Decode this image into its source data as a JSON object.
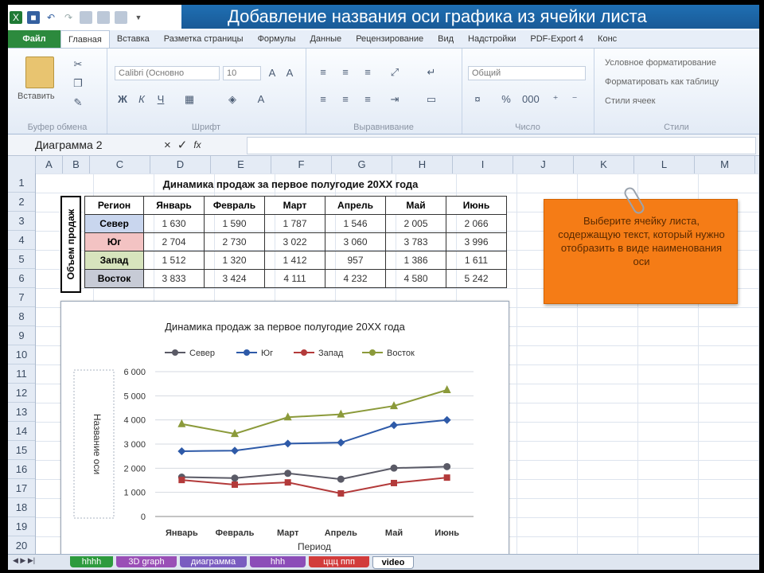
{
  "window": {
    "title_banner": "Добавление названия оси графика из ячейки листа"
  },
  "ribbon": {
    "file_tab": "Файл",
    "tabs": [
      "Главная",
      "Вставка",
      "Разметка страницы",
      "Формулы",
      "Данные",
      "Рецензирование",
      "Вид",
      "Надстройки",
      "PDF-Export 4",
      "Конс"
    ],
    "active_tab": "Главная",
    "clipboard": {
      "paste_label": "Вставить",
      "group_label": "Буфер обмена"
    },
    "font": {
      "font_name": "Calibri (Основно",
      "font_size": "10",
      "group_label": "Шрифт"
    },
    "alignment": {
      "group_label": "Выравнивание"
    },
    "number": {
      "format": "Общий",
      "group_label": "Число"
    },
    "styles": {
      "items": [
        "Условное форматирование",
        "Форматировать как таблицу",
        "Стили ячеек"
      ],
      "group_label": "Стили"
    }
  },
  "formula_bar": {
    "name_box": "Диаграмма 2",
    "cancel": "×",
    "enter": "✓",
    "fx": "fx",
    "value": ""
  },
  "sheet": {
    "columns": [
      "A",
      "B",
      "C",
      "D",
      "E",
      "F",
      "G",
      "H",
      "I",
      "J",
      "K",
      "L",
      "M"
    ],
    "rows": [
      "1",
      "2",
      "3",
      "4",
      "5",
      "6",
      "7",
      "8",
      "9",
      "10",
      "11",
      "12",
      "13",
      "14",
      "15",
      "16",
      "17",
      "18",
      "19",
      "20"
    ]
  },
  "table": {
    "title": "Динамика продаж за первое полугодие 20ХХ года",
    "vertical_label": "Объем продаж",
    "header_region": "Регион",
    "months": [
      "Январь",
      "Февраль",
      "Март",
      "Апрель",
      "Май",
      "Июнь"
    ],
    "rows": [
      {
        "region": "Север",
        "values": [
          "1 630",
          "1 590",
          "1 787",
          "1 546",
          "2 005",
          "2 066"
        ],
        "color": "#c9d6ee"
      },
      {
        "region": "Юг",
        "values": [
          "2 704",
          "2 730",
          "3 022",
          "3 060",
          "3 783",
          "3 996"
        ],
        "color": "#f3c3c3"
      },
      {
        "region": "Запад",
        "values": [
          "1 512",
          "1 320",
          "1 412",
          "957",
          "1 386",
          "1 611"
        ],
        "color": "#d7e4bd"
      },
      {
        "region": "Восток",
        "values": [
          "3 833",
          "3 424",
          "4 111",
          "4 232",
          "4 580",
          "5 242"
        ],
        "color": "#c7cbd6"
      }
    ]
  },
  "note": {
    "text": "Выберите ячейку листа, содержащую текст, который нужно отобразить в виде наименования оси"
  },
  "chart_data": {
    "type": "line",
    "title": "Динамика продаж за первое полугодие 20ХХ года",
    "xlabel": "Период",
    "ylabel": "Название оси",
    "categories": [
      "Январь",
      "Февраль",
      "Март",
      "Апрель",
      "Май",
      "Июнь"
    ],
    "ylim": [
      0,
      6000
    ],
    "yticks": [
      "0",
      "1 000",
      "2 000",
      "3 000",
      "4 000",
      "5 000",
      "6 000"
    ],
    "grid": true,
    "legend_position": "top",
    "series": [
      {
        "name": "Север",
        "values": [
          1630,
          1590,
          1787,
          1546,
          2005,
          2066
        ],
        "color": "#5a5a66",
        "marker": "circle"
      },
      {
        "name": "Юг",
        "values": [
          2704,
          2730,
          3022,
          3060,
          3783,
          3996
        ],
        "color": "#2e5aa8",
        "marker": "diamond"
      },
      {
        "name": "Запад",
        "values": [
          1512,
          1320,
          1412,
          957,
          1386,
          1611
        ],
        "color": "#b33a3a",
        "marker": "square"
      },
      {
        "name": "Восток",
        "values": [
          3833,
          3424,
          4111,
          4232,
          4580,
          5242
        ],
        "color": "#8b9a3a",
        "marker": "triangle"
      }
    ]
  },
  "sheet_tabs": [
    {
      "label": "hhhh",
      "color": "#2e9b3e"
    },
    {
      "label": "3D graph",
      "color": "#9a4fb6"
    },
    {
      "label": "диаграмма",
      "color": "#7a5cc0"
    },
    {
      "label": "hhh",
      "color": "#8c4db8"
    },
    {
      "label": "ццц ппп",
      "color": "#d23c3c"
    },
    {
      "label": "video",
      "color": "#ffffff"
    }
  ]
}
